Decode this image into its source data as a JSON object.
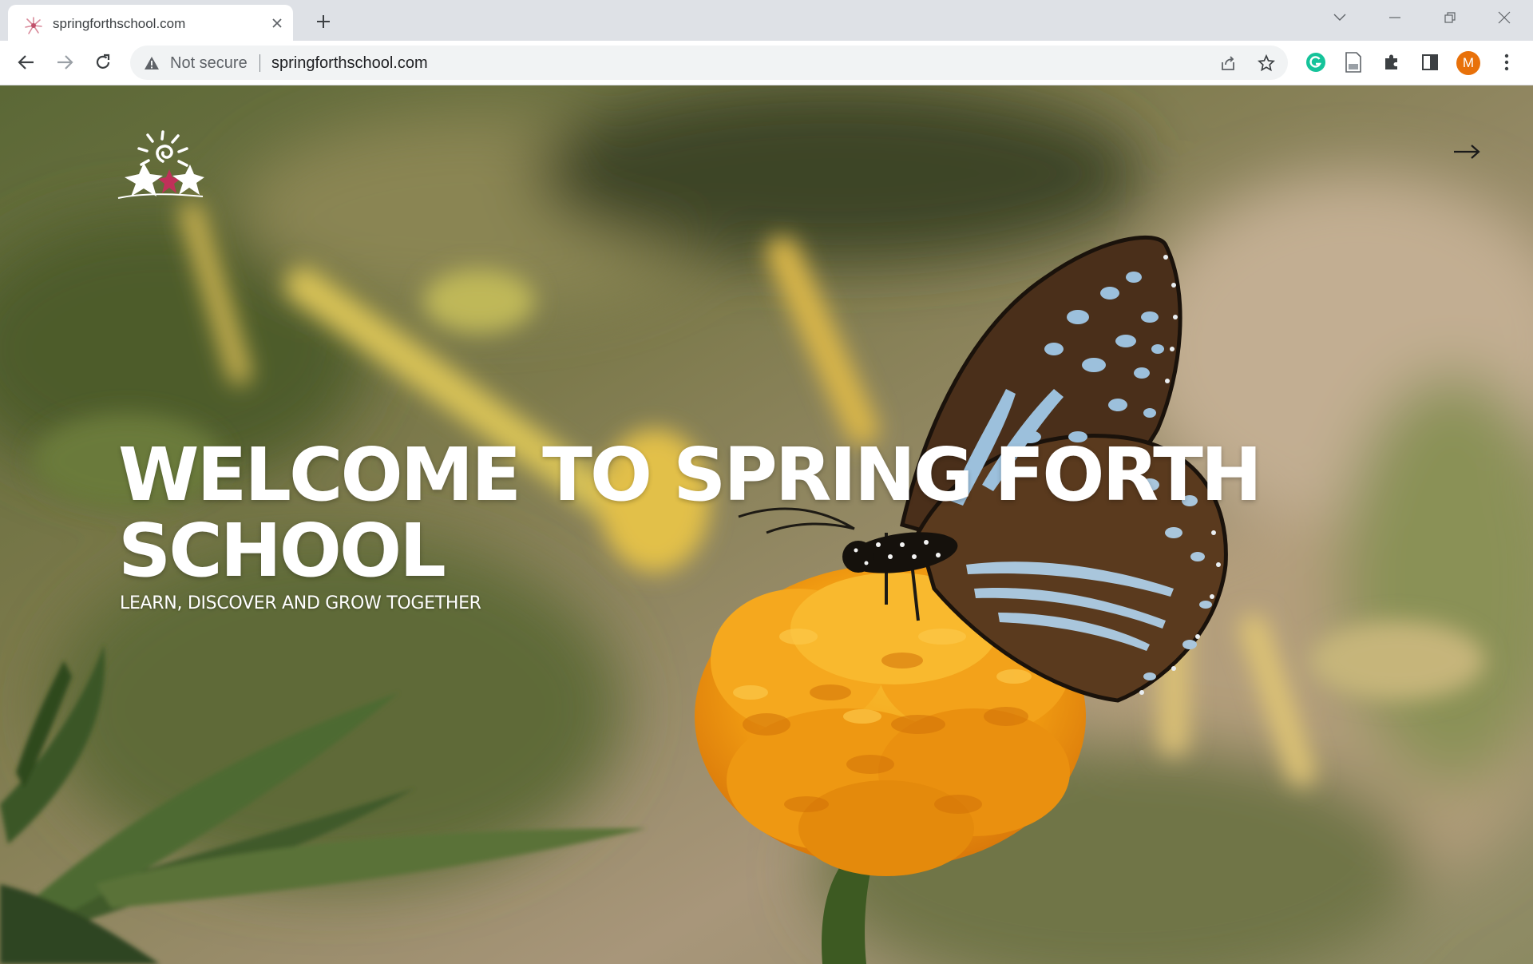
{
  "browser": {
    "tab": {
      "title": "springforthschool.com",
      "favicon": "flower-favicon-icon",
      "close_icon": "close-icon"
    },
    "new_tab_icon": "plus-icon",
    "window_controls": [
      "chevron-down-icon",
      "minimize-icon",
      "restore-icon",
      "close-icon"
    ],
    "nav": [
      "back-arrow-icon",
      "forward-arrow-icon",
      "reload-icon"
    ],
    "omnibox": {
      "security_label": "Not secure",
      "url": "springforthschool.com",
      "icons": [
        "share-icon",
        "star-icon"
      ]
    },
    "extensions": [
      "grammarly-icon",
      "document-icon",
      "puzzle-icon",
      "side-panel-icon"
    ],
    "profile_initial": "M",
    "colors": {
      "tabstrip": "#dee1e6",
      "omnibox": "#f1f3f4",
      "avatar": "#e8710a",
      "grammarly": "#15c39a"
    }
  },
  "page": {
    "logo": "school-logo-icon",
    "menu_icon": "arrow-right-icon",
    "headline": "WELCOME TO SPRING FORTH SCHOOL",
    "tagline": "LEARN, DISCOVER AND GROW TOGETHER",
    "hero_image": "butterfly-on-marigold-photo",
    "colors": {
      "text": "#ffffff",
      "marigold": "#f5a317",
      "foliage": "#6d7a3c"
    }
  }
}
